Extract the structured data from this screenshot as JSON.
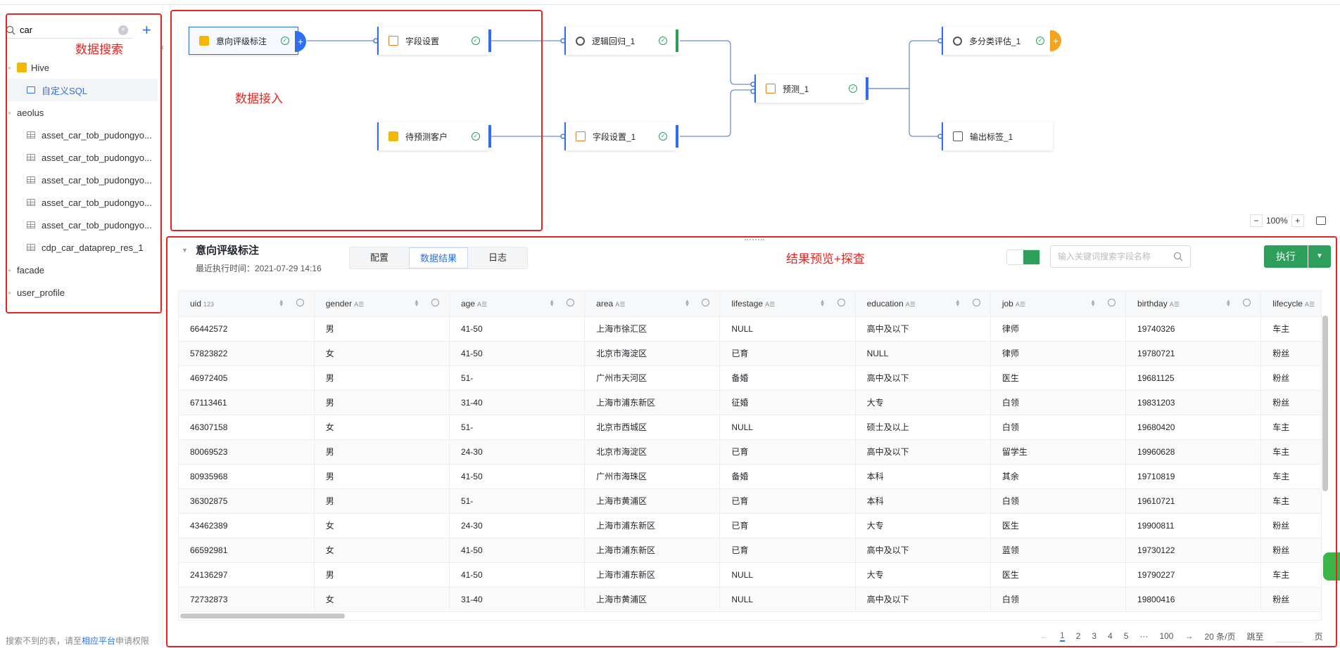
{
  "sidebar": {
    "search": {
      "value": "car",
      "placeholder": ""
    },
    "tree": [
      {
        "label": "Hive",
        "level": 1,
        "type": "hive"
      },
      {
        "label": "自定义SQL",
        "level": 2,
        "type": "sql",
        "selected": true
      },
      {
        "label": "aeolus",
        "level": 1,
        "type": "folder"
      },
      {
        "label": "asset_car_tob_pudongyo...",
        "level": 2,
        "type": "table"
      },
      {
        "label": "asset_car_tob_pudongyo...",
        "level": 2,
        "type": "table"
      },
      {
        "label": "asset_car_tob_pudongyo...",
        "level": 2,
        "type": "table"
      },
      {
        "label": "asset_car_tob_pudongyo...",
        "level": 2,
        "type": "table"
      },
      {
        "label": "asset_car_tob_pudongyo...",
        "level": 2,
        "type": "table"
      },
      {
        "label": "cdp_car_dataprep_res_1",
        "level": 2,
        "type": "table"
      },
      {
        "label": "facade",
        "level": 1,
        "type": "folder"
      },
      {
        "label": "user_profile",
        "level": 1,
        "type": "folder"
      }
    ],
    "footer_prefix": "搜索不到的表，请至",
    "footer_link": "相应平台",
    "footer_suffix": "申请权限"
  },
  "annotations": {
    "search": "数据搜索",
    "ingest": "数据接入",
    "preview": "结果预览+探查"
  },
  "canvas": {
    "nodes": {
      "n1": "意向评级标注",
      "n2": "字段设置",
      "n3": "逻辑回归_1",
      "n4": "待预测客户",
      "n5": "字段设置_1",
      "n6": "预测_1",
      "n7": "多分类评估_1",
      "n8": "输出标签_1"
    },
    "zoom": "100%"
  },
  "panel": {
    "title": "意向评级标注",
    "subtitle": "最近执行时间：2021-07-29 14:16",
    "tabs": [
      "配置",
      "数据结果",
      "日志"
    ],
    "active_tab": "数据结果",
    "search_placeholder": "输入关键词搜索字段名称",
    "run_label": "执行"
  },
  "table": {
    "columns": [
      {
        "name": "uid",
        "type": "123"
      },
      {
        "name": "gender",
        "type": "A☰"
      },
      {
        "name": "age",
        "type": "A☰"
      },
      {
        "name": "area",
        "type": "A☰"
      },
      {
        "name": "lifestage",
        "type": "A☰"
      },
      {
        "name": "education",
        "type": "A☰"
      },
      {
        "name": "job",
        "type": "A☰"
      },
      {
        "name": "birthday",
        "type": "A☰"
      },
      {
        "name": "lifecycle",
        "type": "A☰"
      }
    ],
    "rows": [
      [
        "66442572",
        "男",
        "41-50",
        "上海市徐汇区",
        "NULL",
        "高中及以下",
        "律师",
        "19740326",
        "车主"
      ],
      [
        "57823822",
        "女",
        "41-50",
        "北京市海淀区",
        "已育",
        "NULL",
        "律师",
        "19780721",
        "粉丝"
      ],
      [
        "46972405",
        "男",
        "51-",
        "广州市天河区",
        "备婚",
        "高中及以下",
        "医生",
        "19681125",
        "粉丝"
      ],
      [
        "67113461",
        "男",
        "31-40",
        "上海市浦东新区",
        "征婚",
        "大专",
        "白领",
        "19831203",
        "粉丝"
      ],
      [
        "46307158",
        "女",
        "51-",
        "北京市西城区",
        "NULL",
        "硕士及以上",
        "白领",
        "19680420",
        "车主"
      ],
      [
        "80069523",
        "男",
        "24-30",
        "北京市海淀区",
        "已育",
        "高中及以下",
        "留学生",
        "19960628",
        "车主"
      ],
      [
        "80935968",
        "男",
        "41-50",
        "广州市海珠区",
        "备婚",
        "本科",
        "其余",
        "19710819",
        "车主"
      ],
      [
        "36302875",
        "男",
        "51-",
        "上海市黄浦区",
        "已育",
        "本科",
        "白领",
        "19610721",
        "车主"
      ],
      [
        "43462389",
        "女",
        "24-30",
        "上海市浦东新区",
        "已育",
        "大专",
        "医生",
        "19900811",
        "粉丝"
      ],
      [
        "66592981",
        "女",
        "41-50",
        "上海市浦东新区",
        "已育",
        "高中及以下",
        "蓝领",
        "19730122",
        "粉丝"
      ],
      [
        "24136297",
        "男",
        "41-50",
        "上海市浦东新区",
        "NULL",
        "大专",
        "医生",
        "19790227",
        "车主"
      ],
      [
        "72732873",
        "女",
        "31-40",
        "上海市黄浦区",
        "NULL",
        "高中及以下",
        "白领",
        "19800416",
        "粉丝"
      ]
    ]
  },
  "pager": {
    "pages": [
      "1",
      "2",
      "3",
      "4",
      "5",
      "···",
      "100"
    ],
    "current": "1",
    "page_size": "20 条/页",
    "jump": "跳至",
    "page_suffix": "页"
  }
}
